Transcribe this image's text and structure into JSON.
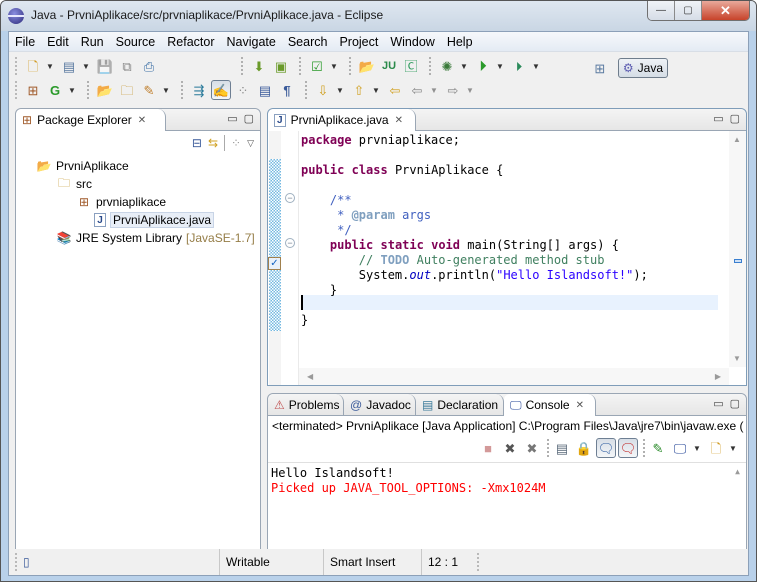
{
  "window": {
    "title": "Java - PrvniAplikace/src/prvniaplikace/PrvniAplikace.java - Eclipse",
    "buttons": {
      "minimize": "—",
      "maximize": "▢",
      "close": "✕"
    }
  },
  "menu": [
    "File",
    "Edit",
    "Run",
    "Source",
    "Refactor",
    "Navigate",
    "Search",
    "Project",
    "Window",
    "Help"
  ],
  "toolbar": {
    "row1": [
      "new-wizard",
      "new-java-project",
      "save",
      "save-all",
      "print",
      "android-sdk-manager",
      "android-avd-manager",
      "checkbox-task",
      "open-type",
      "new-junit-test",
      "new-java-class",
      "debug",
      "run",
      "run-external-tools"
    ],
    "row2": [
      "new-package",
      "new-class",
      "open-project",
      "open-folder",
      "edit-pen",
      "open-call-hierarchy",
      "toggle-mark-occurrences",
      "toggle-ant-editor",
      "toggle-block-selection",
      "show-whitespace",
      "next-annotation",
      "previous-annotation",
      "last-edit-location",
      "back",
      "forward"
    ]
  },
  "perspective": {
    "open_label": "",
    "active": "Java"
  },
  "package_explorer": {
    "tab_label": "Package Explorer",
    "tree": [
      {
        "label": "PrvniAplikace",
        "icon": "project-folder-icon",
        "level": 0
      },
      {
        "label": "src",
        "icon": "source-folder-icon",
        "level": 1
      },
      {
        "label": "prvniaplikace",
        "icon": "package-icon",
        "level": 2
      },
      {
        "label": "PrvniAplikace.java",
        "icon": "java-file-icon",
        "level": 3,
        "selected": true
      },
      {
        "label": "JRE System Library",
        "decoration": "[JavaSE-1.7]",
        "icon": "library-icon",
        "level": 1
      }
    ]
  },
  "editor": {
    "tab_label": "PrvniAplikace.java",
    "code": {
      "l1_kw": "package",
      "l1_rest": " prvniaplikace;",
      "l3_kw1": "public",
      "l3_kw2": "class",
      "l3_rest": " PrvniAplikace {",
      "l5": "    /**",
      "l6_star": "     * ",
      "l6_tag": "@param",
      "l6_rest": " args",
      "l7": "     */",
      "l8_kw1": "public",
      "l8_kw2": "static",
      "l8_kw3": "void",
      "l8_rest": " main(String[] args) {",
      "l9_slash": "        // ",
      "l9_todo": "TODO",
      "l9_rest": " Auto-generated method stub",
      "l10_a": "        System.",
      "l10_out": "out",
      "l10_b": ".println(",
      "l10_str": "\"Hello Islandsoft!\"",
      "l10_c": ");",
      "l11": "    }",
      "l13": "}"
    },
    "cursor_line": 12
  },
  "bottom_panel": {
    "tabs": [
      {
        "label": "Problems",
        "icon": "problems-icon"
      },
      {
        "label": "Javadoc",
        "icon": "at-icon"
      },
      {
        "label": "Declaration",
        "icon": "declaration-icon"
      },
      {
        "label": "Console",
        "icon": "console-icon",
        "active": true
      }
    ],
    "console_info": "<terminated> PrvniAplikace [Java Application] C:\\Program Files\\Java\\jre7\\bin\\javaw.exe (",
    "output": [
      "Hello Islandsoft!",
      "Picked up JAVA_TOOL_OPTIONS: -Xmx1024M"
    ],
    "colors": {
      "stdout": "#000000",
      "stderr": "#ff0000"
    }
  },
  "statusbar": {
    "writable": "Writable",
    "insert_mode": "Smart Insert",
    "position": "12 : 1"
  }
}
